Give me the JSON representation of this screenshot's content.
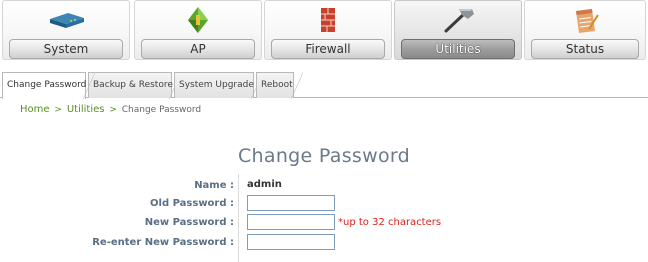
{
  "nav": {
    "items": [
      {
        "label": "System",
        "icon": "router-icon"
      },
      {
        "label": "AP",
        "icon": "access-point-icon"
      },
      {
        "label": "Firewall",
        "icon": "firewall-icon"
      },
      {
        "label": "Utilities",
        "icon": "hammer-icon",
        "active": true
      },
      {
        "label": "Status",
        "icon": "notepad-icon"
      }
    ]
  },
  "tabs": [
    {
      "label": "Change Password",
      "active": true
    },
    {
      "label": "Backup & Restore"
    },
    {
      "label": "System Upgrade"
    },
    {
      "label": "Reboot"
    }
  ],
  "breadcrumb": {
    "home": "Home",
    "sep1": ">",
    "section": "Utilities",
    "sep2": ">",
    "current": "Change Password"
  },
  "page": {
    "title": "Change Password"
  },
  "form": {
    "name_label": "Name :",
    "name_value": "admin",
    "old_password_label": "Old Password :",
    "old_password_value": "",
    "new_password_label": "New Password :",
    "new_password_value": "",
    "new_password_hint": "*up to 32 characters",
    "reenter_label": "Re-enter New Password :",
    "reenter_value": ""
  },
  "colors": {
    "link_green": "#5b8f22",
    "label_blue": "#5a6e85",
    "title_gray": "#6b7a8a",
    "hint_red": "#e0201b",
    "active_tab_gray": "#9e9e9e"
  }
}
